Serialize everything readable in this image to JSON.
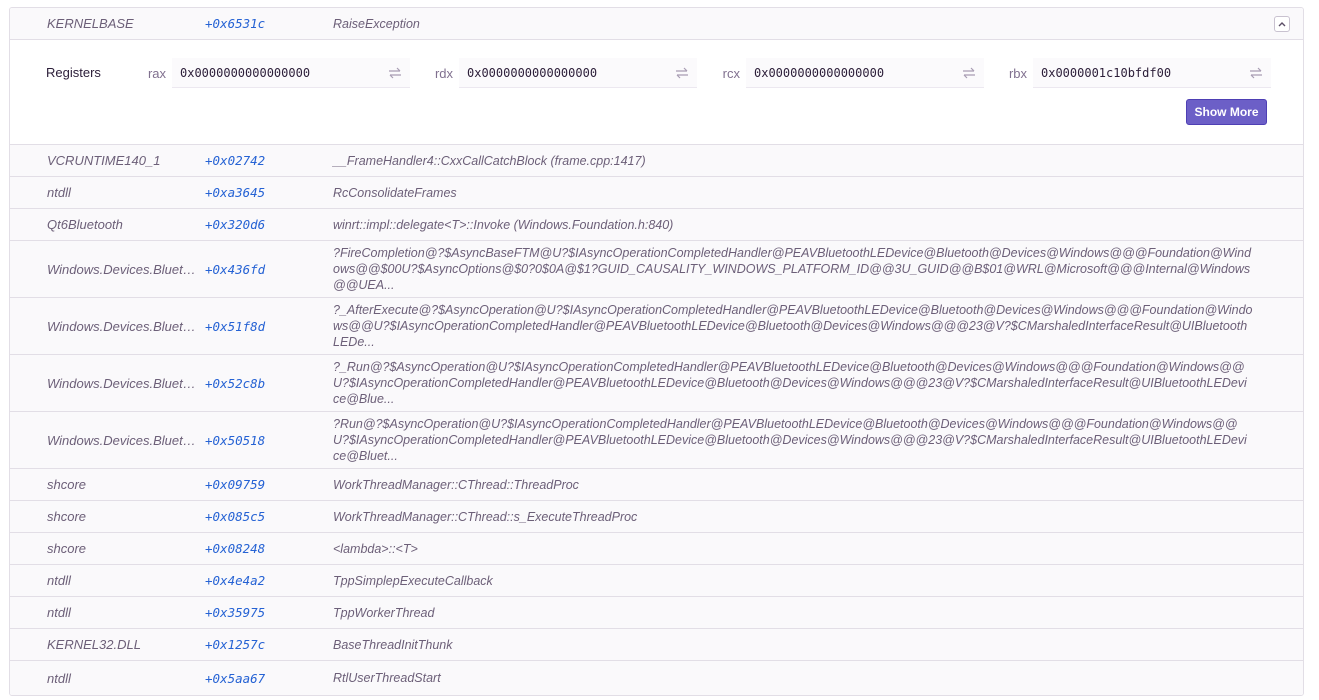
{
  "top_frame": {
    "package": "KERNELBASE",
    "address": "+0x6531c",
    "function": "RaiseException"
  },
  "registers": {
    "label": "Registers",
    "items": [
      {
        "name": "rax",
        "value": "0x0000000000000000"
      },
      {
        "name": "rdx",
        "value": "0x0000000000000000"
      },
      {
        "name": "rcx",
        "value": "0x0000000000000000"
      },
      {
        "name": "rbx",
        "value": "0x0000001c10bfdf00"
      }
    ],
    "show_more_label": "Show More"
  },
  "frames": [
    {
      "package": "VCRUNTIME140_1",
      "address": "+0x02742",
      "function": "__FrameHandler4::CxxCallCatchBlock (frame.cpp:1417)"
    },
    {
      "package": "ntdll",
      "address": "+0xa3645",
      "function": "RcConsolidateFrames"
    },
    {
      "package": "Qt6Bluetooth",
      "address": "+0x320d6",
      "function": "winrt::impl::delegate<T>::Invoke (Windows.Foundation.h:840)"
    },
    {
      "package": "Windows.Devices.Bluet…",
      "address": "+0x436fd",
      "function": "?FireCompletion@?$AsyncBaseFTM@U?$IAsyncOperationCompletedHandler@PEAVBluetoothLEDevice@Bluetooth@Devices@Windows@@@Foundation@Windows@@$00U?$AsyncOptions@$0?0$0A@$1?GUID_CAUSALITY_WINDOWS_PLATFORM_ID@@3U_GUID@@B$01@WRL@Microsoft@@@Internal@Windows@@UEA..."
    },
    {
      "package": "Windows.Devices.Bluet…",
      "address": "+0x51f8d",
      "function": "?_AfterExecute@?$AsyncOperation@U?$IAsyncOperationCompletedHandler@PEAVBluetoothLEDevice@Bluetooth@Devices@Windows@@@Foundation@Windows@@U?$IAsyncOperationCompletedHandler@PEAVBluetoothLEDevice@Bluetooth@Devices@Windows@@@23@V?$CMarshaledInterfaceResult@UIBluetoothLEDe..."
    },
    {
      "package": "Windows.Devices.Bluet…",
      "address": "+0x52c8b",
      "function": "?_Run@?$AsyncOperation@U?$IAsyncOperationCompletedHandler@PEAVBluetoothLEDevice@Bluetooth@Devices@Windows@@@Foundation@Windows@@U?$IAsyncOperationCompletedHandler@PEAVBluetoothLEDevice@Bluetooth@Devices@Windows@@@23@V?$CMarshaledInterfaceResult@UIBluetoothLEDevice@Blue..."
    },
    {
      "package": "Windows.Devices.Bluet…",
      "address": "+0x50518",
      "function": "?Run@?$AsyncOperation@U?$IAsyncOperationCompletedHandler@PEAVBluetoothLEDevice@Bluetooth@Devices@Windows@@@Foundation@Windows@@U?$IAsyncOperationCompletedHandler@PEAVBluetoothLEDevice@Bluetooth@Devices@Windows@@@23@V?$CMarshaledInterfaceResult@UIBluetoothLEDevice@Bluet..."
    },
    {
      "package": "shcore",
      "address": "+0x09759",
      "function": "WorkThreadManager::CThread::ThreadProc"
    },
    {
      "package": "shcore",
      "address": "+0x085c5",
      "function": "WorkThreadManager::CThread::s_ExecuteThreadProc"
    },
    {
      "package": "shcore",
      "address": "+0x08248",
      "function": "<lambda>::<T>"
    },
    {
      "package": "ntdll",
      "address": "+0x4e4a2",
      "function": "TppSimplepExecuteCallback"
    },
    {
      "package": "ntdll",
      "address": "+0x35975",
      "function": "TppWorkerThread"
    },
    {
      "package": "KERNEL32.DLL",
      "address": "+0x1257c",
      "function": "BaseThreadInitThunk"
    },
    {
      "package": "ntdll",
      "address": "+0x5aa67",
      "function": "RtlUserThreadStart"
    }
  ]
}
